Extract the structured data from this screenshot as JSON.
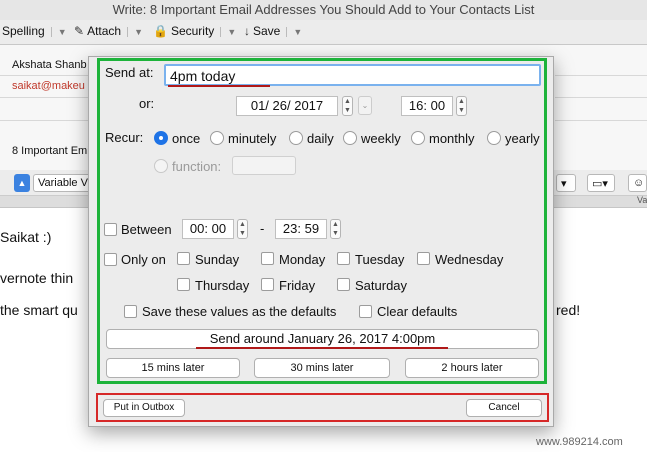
{
  "window": {
    "title": "Write: 8 Important Email Addresses You Should Add to Your Contacts List"
  },
  "toolbar": {
    "spelling": "Spelling",
    "attach": "Attach",
    "security": "Security",
    "save": "Save"
  },
  "mail_header": {
    "from": "Akshata Shanb",
    "to": "saikat@makeu",
    "subject": "8 Important Emi"
  },
  "format_bar": {
    "variable": "Variable V",
    "right_label": "Va"
  },
  "mail_body": {
    "line1": "Saikat :)",
    "line2": "vernote thin",
    "line3_left": "the smart qu",
    "line3_right": "red!"
  },
  "send_later": {
    "send_at_label": "Send at:",
    "send_at_value": "4pm today",
    "or_label": "or:",
    "date": "01/ 26/  2017",
    "time": "16: 00",
    "recur_label": "Recur:",
    "recur_options": [
      "once",
      "minutely",
      "daily",
      "weekly",
      "monthly",
      "yearly"
    ],
    "recur_selected": "once",
    "function_label": "function:",
    "between_label": "Between",
    "between_from": "00: 00",
    "between_dash": "-",
    "between_to": "23: 59",
    "only_on_label": "Only on",
    "days": [
      "Sunday",
      "Monday",
      "Tuesday",
      "Wednesday",
      "Thursday",
      "Friday",
      "Saturday"
    ],
    "save_defaults_label": "Save these values as the defaults",
    "clear_defaults_label": "Clear defaults",
    "send_around_button": "Send around January 26, 2017 4:00pm",
    "quick_buttons": [
      "15 mins later",
      "30 mins later",
      "2 hours later"
    ],
    "put_in_outbox_button": "Put in Outbox",
    "cancel_button": "Cancel"
  },
  "watermark": "www.989214.com",
  "colors": {
    "highlight_green": "#1db33a",
    "highlight_red": "#d62828",
    "accent_blue": "#1e73e6"
  }
}
